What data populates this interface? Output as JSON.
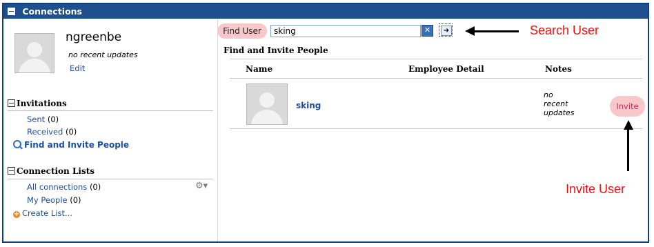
{
  "widget": {
    "title": "Connections"
  },
  "profile": {
    "username": "ngreenbe",
    "status": "no recent updates",
    "edit_label": "Edit"
  },
  "invitations": {
    "heading": "Invitations",
    "sent_label": "Sent",
    "sent_count": "(0)",
    "received_label": "Received",
    "received_count": "(0)",
    "find_invite_label": "Find and Invite People"
  },
  "connection_lists": {
    "heading": "Connection Lists",
    "all_label": "All connections",
    "all_count": "(0)",
    "my_people_label": "My People",
    "my_people_count": "(0)",
    "create_label": "Create List..."
  },
  "search": {
    "find_user_label": "Find User",
    "value": "sking",
    "clear_symbol": "✕",
    "go_symbol": "➜"
  },
  "results": {
    "title": "Find and Invite People",
    "columns": {
      "name": "Name",
      "employee_detail": "Employee Detail",
      "notes": "Notes"
    },
    "rows": [
      {
        "name": "sking",
        "notes_line1": "no",
        "notes_line2": "recent",
        "notes_line3": "updates",
        "action": "Invite"
      }
    ]
  },
  "annotations": {
    "search_user": "Search User",
    "invite_user": "Invite User"
  },
  "colors": {
    "titlebar": "#1f4f8c",
    "link": "#1d4e9e",
    "highlight": "#f7c7c9",
    "annotation": "#ee1111"
  },
  "icons": [
    "collapse-icon",
    "magnifier-icon",
    "add-icon",
    "gear-icon",
    "clear-icon",
    "go-arrow-icon",
    "avatar-placeholder"
  ]
}
